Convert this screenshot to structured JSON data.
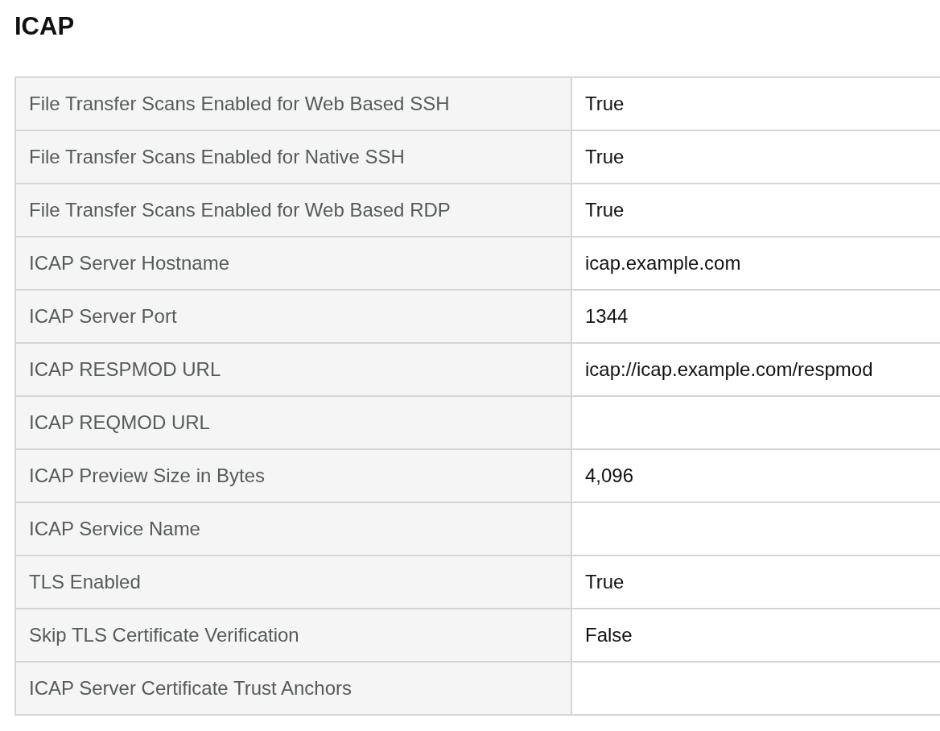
{
  "heading": "ICAP",
  "rows": [
    {
      "label": "File Transfer Scans Enabled for Web Based SSH",
      "value": "True"
    },
    {
      "label": "File Transfer Scans Enabled for Native SSH",
      "value": "True"
    },
    {
      "label": "File Transfer Scans Enabled for Web Based RDP",
      "value": "True"
    },
    {
      "label": "ICAP Server Hostname",
      "value": "icap.example.com"
    },
    {
      "label": "ICAP Server Port",
      "value": "1344"
    },
    {
      "label": "ICAP RESPMOD URL",
      "value": "icap://icap.example.com/respmod"
    },
    {
      "label": "ICAP REQMOD URL"
    },
    {
      "label": "ICAP Preview Size in Bytes",
      "value": "4,096"
    },
    {
      "label": "ICAP Service Name"
    },
    {
      "label": "TLS Enabled",
      "value": "True"
    },
    {
      "label": "Skip TLS Certificate Verification",
      "value": "False"
    },
    {
      "label": "ICAP Server Certificate Trust Anchors"
    }
  ]
}
